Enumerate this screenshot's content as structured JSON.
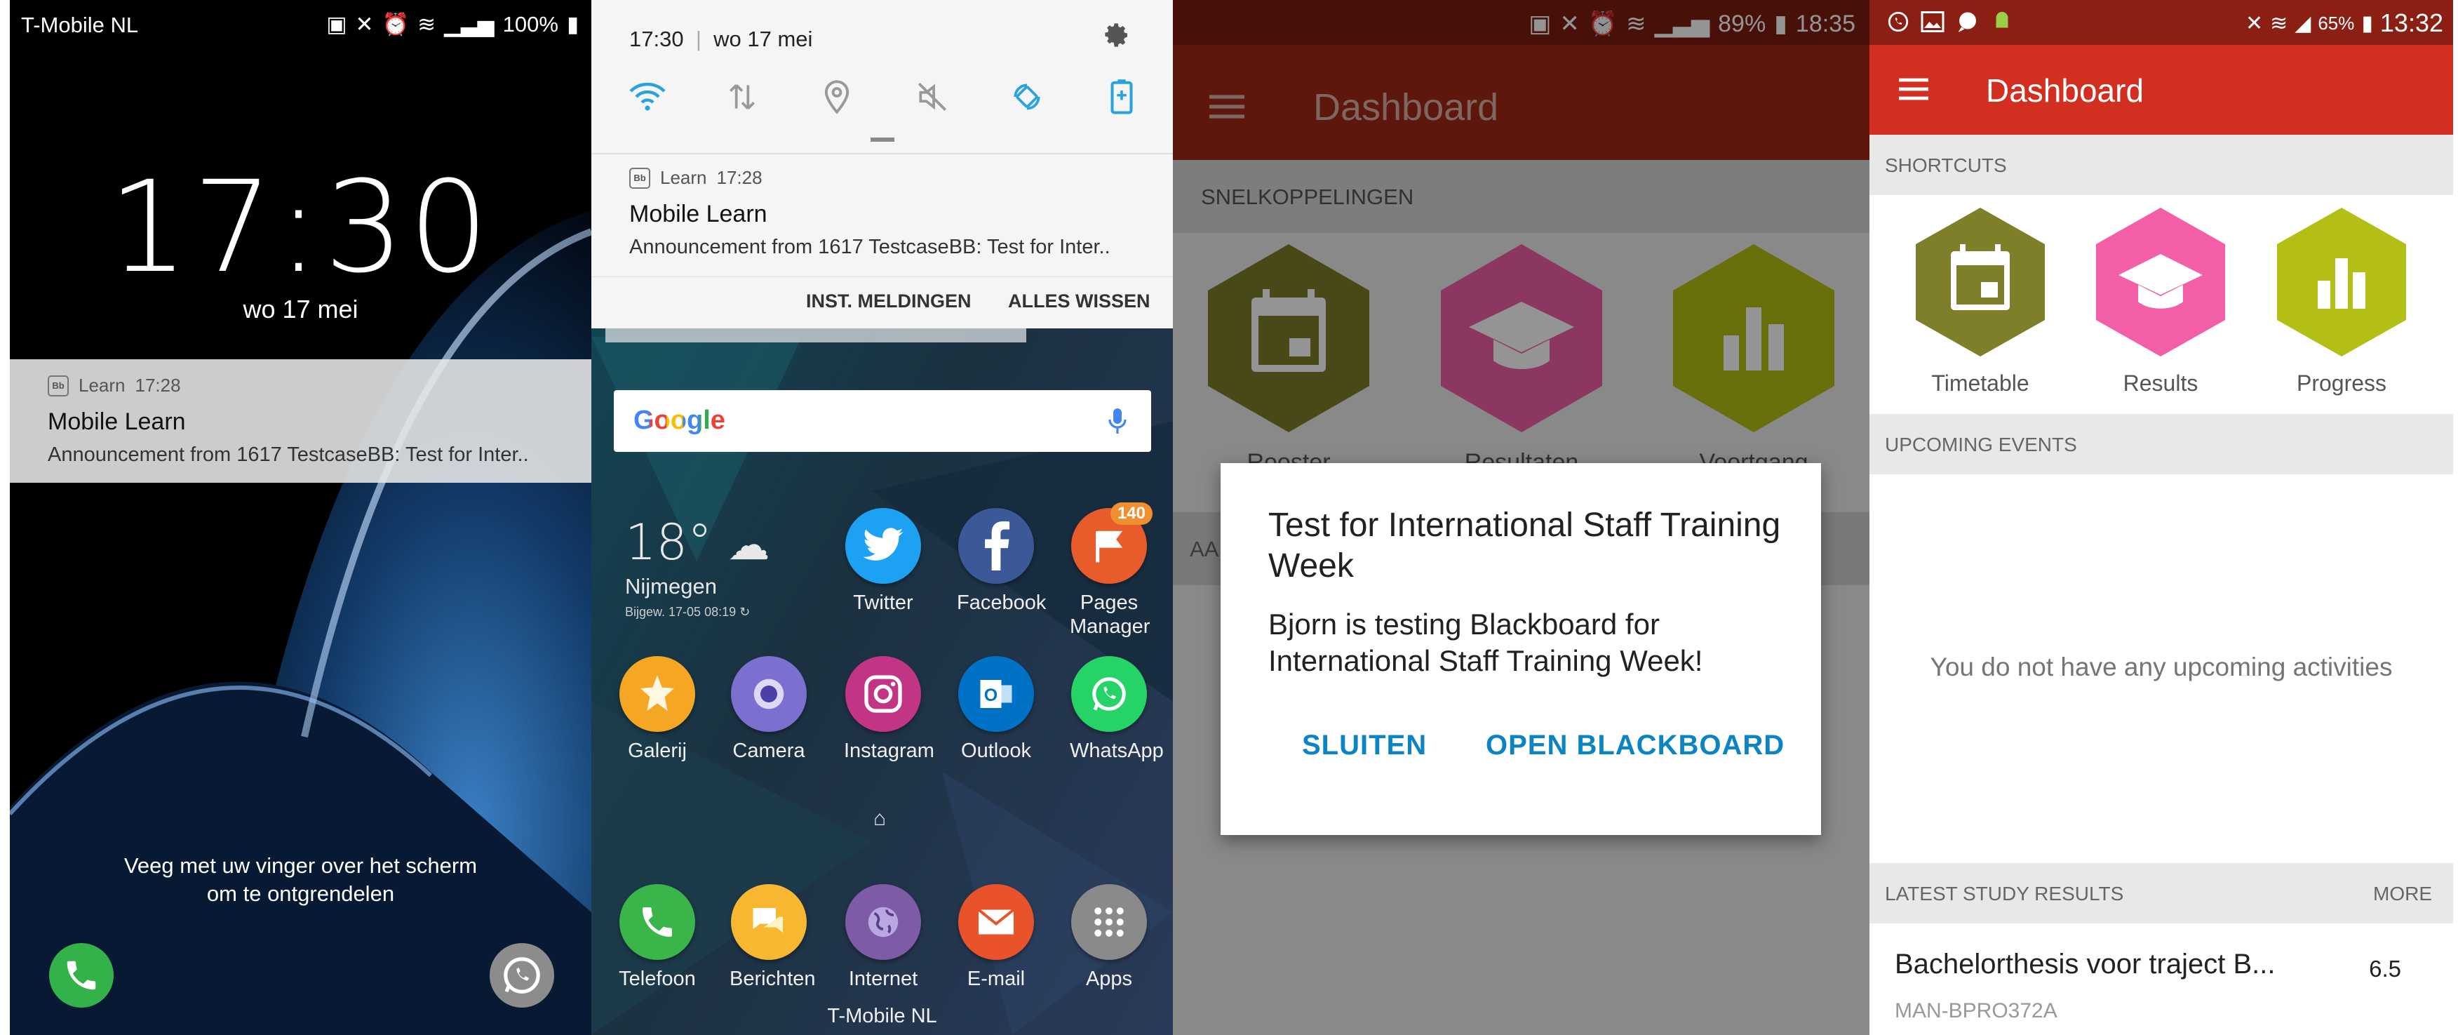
{
  "lockscreen": {
    "carrier": "T-Mobile  NL",
    "battery": "100%",
    "time": "17:30",
    "date": "wo 17 mei",
    "notification": {
      "app": "Learn",
      "time": "17:28",
      "title": "Mobile Learn",
      "body": "Announcement from 1617 TestcaseBB: Test for Inter.."
    },
    "unlock_hint": "Veeg met uw vinger over het scherm\nom te ontgrendelen"
  },
  "shade": {
    "time": "17:30",
    "date": "wo 17 mei",
    "notification": {
      "app": "Learn",
      "time": "17:28",
      "title": "Mobile Learn",
      "body": "Announcement from 1617 TestcaseBB: Test for Inter.."
    },
    "action_settings": "INST. MELDINGEN",
    "action_clear": "ALLES WISSEN",
    "search_logo": "Google",
    "weather": {
      "temp": "18°",
      "city": "Nijmegen",
      "updated": "Bijgew. 17-05  08:19"
    },
    "apps_row1": [
      {
        "label": "Twitter",
        "color": "#1da1f2"
      },
      {
        "label": "Facebook",
        "color": "#3b5998"
      },
      {
        "label": "Pages\nManager",
        "color": "#e85c2c",
        "badge": "140"
      }
    ],
    "apps_row2": [
      {
        "label": "Galerij",
        "color": "#f5a623"
      },
      {
        "label": "Camera",
        "color": "#7b6fcf"
      },
      {
        "label": "Instagram",
        "color": "#c13584"
      },
      {
        "label": "Outlook",
        "color": "#0072c6"
      },
      {
        "label": "WhatsApp",
        "color": "#25d366"
      }
    ],
    "dock": [
      {
        "label": "Telefoon",
        "color": "#39b54a"
      },
      {
        "label": "Berichten",
        "color": "#f7b731"
      },
      {
        "label": "Internet",
        "color": "#7d5ba6"
      },
      {
        "label": "E-mail",
        "color": "#e8532b"
      },
      {
        "label": "Apps",
        "color": "#8a8a8a"
      }
    ],
    "carrier": "T-Mobile  NL"
  },
  "dialog_screen": {
    "battery": "89%",
    "time": "18:35",
    "title": "Dashboard",
    "section": "SNELKOPPELINGEN",
    "shortcuts": [
      "Rooster",
      "Resultaten",
      "Voortgang"
    ],
    "section2": "AA",
    "dialog": {
      "title": "Test for International Staff Training Week",
      "message": "Bjorn is testing Blackboard for International Staff Training Week!",
      "close": "SLUITEN",
      "open": "OPEN BLACKBOARD"
    }
  },
  "dashboard": {
    "battery": "65%",
    "time": "13:32",
    "title": "Dashboard",
    "shortcuts_header": "SHORTCUTS",
    "shortcuts": [
      {
        "label": "Timetable",
        "color": "#7f7f2a",
        "icon": "calendar-icon"
      },
      {
        "label": "Results",
        "color": "#f25fa7",
        "icon": "graduation-cap-icon"
      },
      {
        "label": "Progress",
        "color": "#b3bf14",
        "icon": "bar-chart-icon"
      }
    ],
    "events_header": "UPCOMING EVENTS",
    "no_events": "You do not have any upcoming activities",
    "results_header": "LATEST STUDY RESULTS",
    "more": "MORE",
    "result": {
      "name": "Bachelorthesis voor traject B...",
      "grade": "6.5",
      "code": "MAN-BPRO372A"
    }
  }
}
